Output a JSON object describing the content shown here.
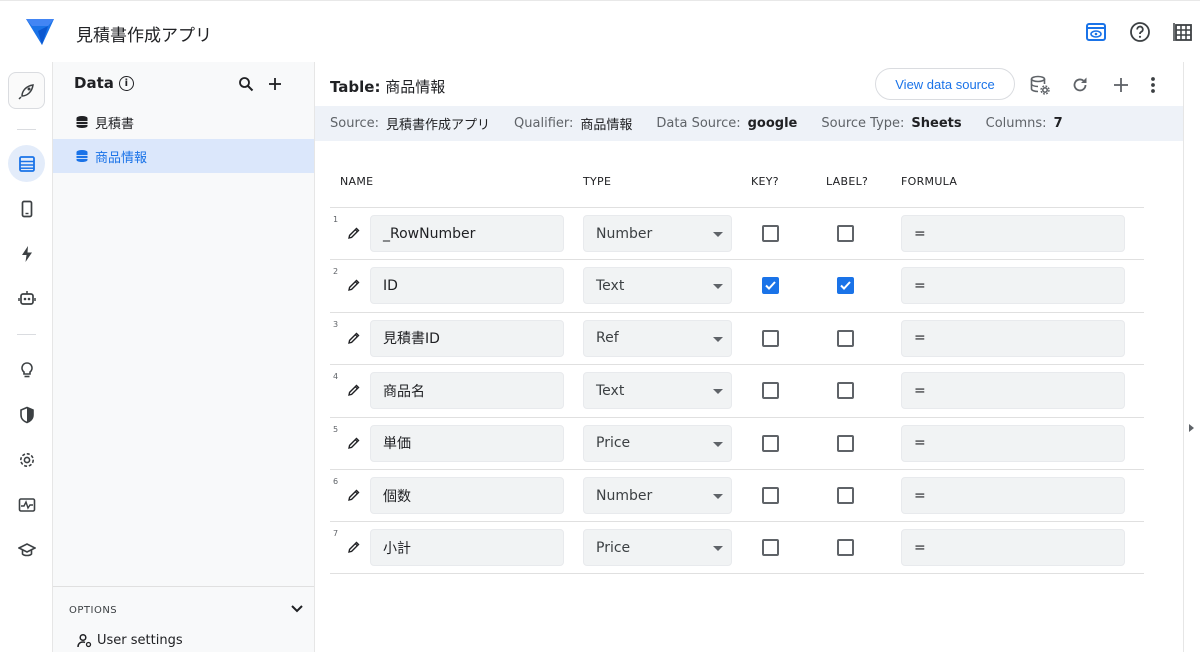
{
  "app": {
    "title": "見積書作成アプリ"
  },
  "topbar": {
    "icons": [
      "preview-icon",
      "help-icon",
      "grid-icon"
    ]
  },
  "rail": {
    "items": [
      "rocket-icon",
      "data-icon",
      "views-icon",
      "automation-icon",
      "bot-icon",
      "intelligence-icon",
      "security-icon",
      "settings-icon",
      "monitor-icon",
      "learn-icon"
    ]
  },
  "sidebar": {
    "header": "Data",
    "info_glyph": "i",
    "items": [
      {
        "label": "見積書",
        "selected": false
      },
      {
        "label": "商品情報",
        "selected": true
      }
    ],
    "options": {
      "label": "OPTIONS",
      "item": "User settings"
    }
  },
  "main": {
    "title_prefix": "Table:",
    "title_value": "商品情報",
    "view_source_label": "View data source",
    "info": {
      "source_label": "Source:",
      "source": "見積書作成アプリ",
      "qualifier_label": "Qualifier:",
      "qualifier": "商品情報",
      "datasource_label": "Data Source:",
      "datasource": "google",
      "sourcetype_label": "Source Type:",
      "sourcetype": "Sheets",
      "columns_label": "Columns:",
      "columns": "7"
    },
    "headers": {
      "name": "NAME",
      "type": "TYPE",
      "key": "KEY?",
      "label": "LABEL?",
      "formula": "FORMULA"
    },
    "rows": [
      {
        "num": "1",
        "name": "_RowNumber",
        "type": "Number",
        "key": false,
        "label": false,
        "formula": "="
      },
      {
        "num": "2",
        "name": "ID",
        "type": "Text",
        "key": true,
        "label": true,
        "formula": "="
      },
      {
        "num": "3",
        "name": "見積書ID",
        "type": "Ref",
        "key": false,
        "label": false,
        "formula": "="
      },
      {
        "num": "4",
        "name": "商品名",
        "type": "Text",
        "key": false,
        "label": false,
        "formula": "="
      },
      {
        "num": "5",
        "name": "単価",
        "type": "Price",
        "key": false,
        "label": false,
        "formula": "="
      },
      {
        "num": "6",
        "name": "個数",
        "type": "Number",
        "key": false,
        "label": false,
        "formula": "="
      },
      {
        "num": "7",
        "name": "小計",
        "type": "Price",
        "key": false,
        "label": false,
        "formula": "="
      }
    ]
  },
  "colors": {
    "accent": "#1a73e8",
    "selected_bg": "#dbe7fb",
    "infobar_bg": "#eef2f8"
  }
}
